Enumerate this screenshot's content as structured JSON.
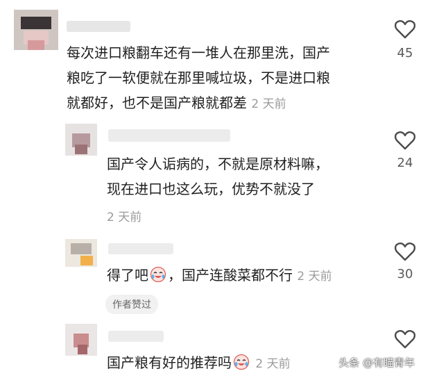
{
  "comments": [
    {
      "text_lines": [
        "每次进口粮翻车还有一堆人在那里洗，国产",
        "粮吃了一软便就在那里喊垃圾，不是进口粮",
        "就都好，也不是国产粮就都差"
      ],
      "time": "2 天前",
      "likes": "45"
    },
    {
      "text_lines": [
        "国产令人诟病的，不就是原材料嘛，",
        "现在进口也这么玩，优势不就没了"
      ],
      "time": "2 天前",
      "likes": "24"
    },
    {
      "text_before_emoji": "得了吧",
      "text_after_emoji": "，国产连酸菜都不行",
      "time": "2 天前",
      "likes": "30",
      "badge": "作者赞过"
    },
    {
      "text_before_emoji": "国产粮有好的推荐吗",
      "time": "2 天前"
    }
  ],
  "watermark": "头条 @有瞄青年",
  "icons": {
    "like": "heart-outline-icon",
    "emoji": "crying-laughing-emoji-icon"
  },
  "colors": {
    "text": "#1f1f1f",
    "muted": "#9b9b9b",
    "icon": "#4a4a4a"
  }
}
